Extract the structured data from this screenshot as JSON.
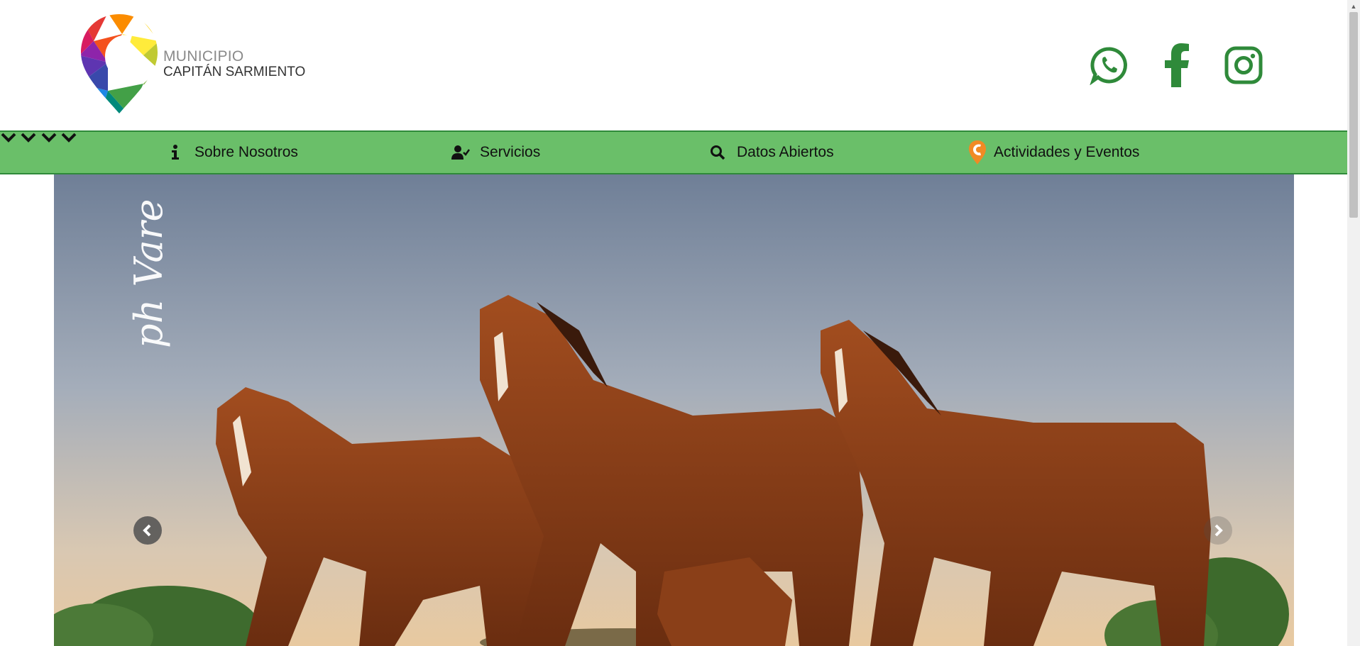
{
  "brand": {
    "line1": "MUNICIPIO",
    "line2": "CAPITÁN SARMIENTO"
  },
  "social": [
    {
      "name": "whatsapp-icon"
    },
    {
      "name": "facebook-icon"
    },
    {
      "name": "instagram-icon"
    }
  ],
  "nav": {
    "items": [
      {
        "label": "Sobre Nosotros",
        "icon": "info-icon"
      },
      {
        "label": "Servicios",
        "icon": "user-check-icon"
      },
      {
        "label": "Datos Abiertos",
        "icon": "search-icon"
      },
      {
        "label": "Actividades y Eventos",
        "icon": "logo-mark-icon"
      }
    ]
  },
  "hero": {
    "watermark": "ph Vare"
  },
  "colors": {
    "green": "#2f8a3a",
    "nav_bg": "#6abf69"
  }
}
